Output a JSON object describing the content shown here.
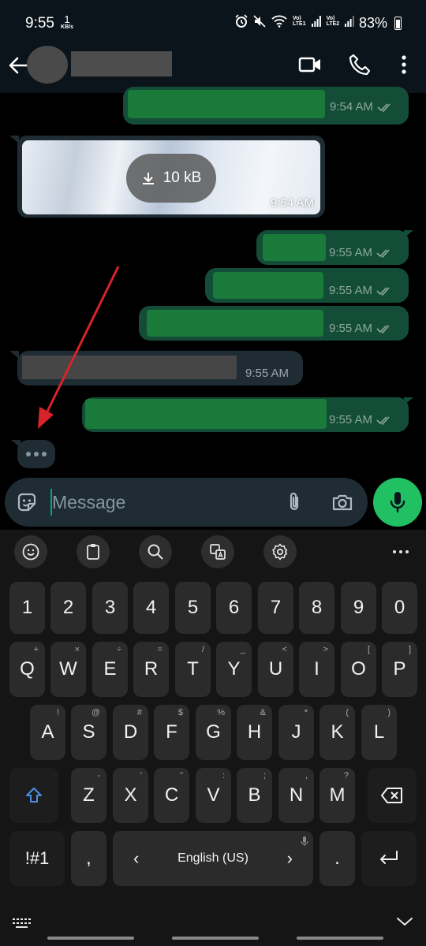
{
  "status_bar": {
    "time": "9:55",
    "net_speed": "1",
    "net_unit": "KB/s",
    "sim1": "LTE1",
    "sim2": "LTE2",
    "volte": "Vo)",
    "battery": "83%"
  },
  "header": {
    "back_icon": "arrow-left-icon",
    "video_icon": "video-call-icon",
    "call_icon": "phone-icon",
    "menu_icon": "more-vert-icon"
  },
  "messages": [
    {
      "dir": "out",
      "time": "9:54 AM",
      "status": "read"
    },
    {
      "dir": "in",
      "type": "image",
      "download_size": "10 kB",
      "time": "9:54 AM"
    },
    {
      "dir": "out",
      "time": "9:55 AM",
      "status": "read"
    },
    {
      "dir": "out",
      "time": "9:55 AM",
      "status": "read"
    },
    {
      "dir": "out",
      "time": "9:55 AM",
      "status": "read"
    },
    {
      "dir": "in",
      "time": "9:55 AM"
    },
    {
      "dir": "out",
      "time": "9:55 AM",
      "status": "read"
    }
  ],
  "typing_indicator": "•••",
  "composer": {
    "placeholder": "Message",
    "sticker_icon": "sticker-icon",
    "attach_icon": "paperclip-icon",
    "camera_icon": "camera-icon",
    "mic_icon": "mic-icon"
  },
  "keyboard": {
    "toolbar": [
      "emoji-icon",
      "clipboard-icon",
      "search-icon",
      "translate-icon",
      "settings-icon",
      "more-horiz-icon"
    ],
    "numbers": [
      "1",
      "2",
      "3",
      "4",
      "5",
      "6",
      "7",
      "8",
      "9",
      "0"
    ],
    "row1": [
      "Q",
      "W",
      "E",
      "R",
      "T",
      "Y",
      "U",
      "I",
      "O",
      "P"
    ],
    "row1_sub": [
      "+",
      "×",
      "÷",
      "=",
      "/",
      "_",
      "<",
      ">",
      "[",
      "]"
    ],
    "row2": [
      "A",
      "S",
      "D",
      "F",
      "G",
      "H",
      "J",
      "K",
      "L"
    ],
    "row2_sub": [
      "!",
      "@",
      "#",
      "$",
      "%",
      "&",
      "*",
      "(",
      ")"
    ],
    "row3": [
      "Z",
      "X",
      "C",
      "V",
      "B",
      "N",
      "M"
    ],
    "row3_sub": [
      "-",
      "'",
      "\"",
      ":",
      ";",
      ",",
      "?"
    ],
    "symbols_label": "!#1",
    "comma": ",",
    "language": "English (US)",
    "lang_left": "‹",
    "lang_right": "›",
    "period": "."
  },
  "colors": {
    "accent": "#21c063",
    "out_bubble": "#144d37",
    "in_bubble": "#1f2c34",
    "annotation_arrow": "#d8232a"
  }
}
